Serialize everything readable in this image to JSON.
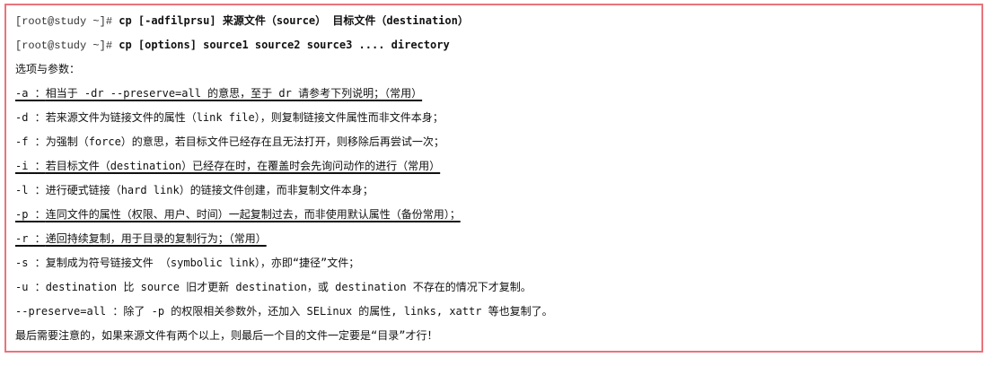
{
  "commands": [
    {
      "prompt": "[root@study ~]# ",
      "command": "cp [-adfilprsu] 来源文件（source） 目标文件（destination）"
    },
    {
      "prompt": "[root@study ~]# ",
      "command": "cp [options] source1 source2 source3 .... directory"
    }
  ],
  "options_heading": "选项与参数：",
  "options": [
    {
      "flag": "-a",
      "sep": "  ：",
      "desc": "相当于 -dr --preserve=all 的意思，至于 dr 请参考下列说明；（常用）",
      "underlined": true
    },
    {
      "flag": "-d",
      "sep": "  ：",
      "desc": "若来源文件为链接文件的属性（link file），则复制链接文件属性而非文件本身；",
      "underlined": false
    },
    {
      "flag": "-f",
      "sep": "  ：",
      "desc": "为强制（force）的意思，若目标文件已经存在且无法打开，则移除后再尝试一次；",
      "underlined": false
    },
    {
      "flag": "-i",
      "sep": "  ：",
      "desc": "若目标文件（destination）已经存在时，在覆盖时会先询问动作的进行（常用）",
      "underlined": true
    },
    {
      "flag": "-l",
      "sep": "  ：",
      "desc": "进行硬式链接（hard link）的链接文件创建，而非复制文件本身；",
      "underlined": false
    },
    {
      "flag": "-p",
      "sep": "  ：",
      "desc": "连同文件的属性（权限、用户、时间）一起复制过去，而非使用默认属性（备份常用）；",
      "underlined": true
    },
    {
      "flag": "-r",
      "sep": "  ：",
      "desc": "递回持续复制，用于目录的复制行为；（常用）",
      "underlined": true
    },
    {
      "flag": "-s",
      "sep": "  ：",
      "desc": "复制成为符号链接文件 （symbolic link），亦即“捷径”文件；",
      "underlined": false
    },
    {
      "flag": "-u",
      "sep": "  ：",
      "desc": "destination 比 source 旧才更新 destination，或 destination 不存在的情况下才复制。",
      "underlined": false
    },
    {
      "flag": "--preserve=all",
      "sep": " ：",
      "desc": "除了 -p 的权限相关参数外，还加入 SELinux 的属性, links, xattr 等也复制了。",
      "underlined": false
    }
  ],
  "footer_note": "最后需要注意的，如果来源文件有两个以上，则最后一个目的文件一定要是“目录”才行！",
  "colors": {
    "border": "#e8747c",
    "text": "#111111"
  }
}
